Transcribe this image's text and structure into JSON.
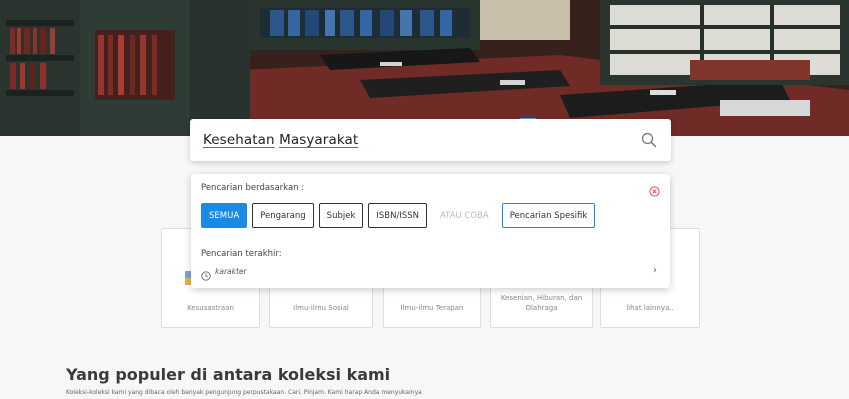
{
  "search": {
    "query_words": [
      "Kesehatan",
      "Masyarakat"
    ]
  },
  "dropdown": {
    "label": "Pencarian berdasarkan :",
    "chips": [
      {
        "label": "SEMUA",
        "state": "active"
      },
      {
        "label": "Pengarang",
        "state": "normal"
      },
      {
        "label": "Subjek",
        "state": "normal"
      },
      {
        "label": "ISBN/ISSN",
        "state": "normal"
      },
      {
        "label": "ATAU COBA",
        "state": "plain"
      },
      {
        "label": "Pencarian Spesifik",
        "state": "outlined"
      }
    ],
    "recent_label": "Pencarian terakhir:",
    "recent_term": "karakter"
  },
  "categories": [
    {
      "label": "Kesusastraan"
    },
    {
      "label": "Ilmu-ilmu Sosial"
    },
    {
      "label": "Ilmu-ilmu Terapan"
    },
    {
      "label": "Kesenian, Hiburan, dan Olahraga"
    },
    {
      "label": "lihat lainnya.."
    }
  ],
  "popular": {
    "title": "Yang populer di antara koleksi kami",
    "subtitle": "Koleksi-koleksi kami yang dibaca oleh banyak pengunjung perpustakaan. Cari, Pinjam. Kami harap Anda menyukainya"
  },
  "colors": {
    "accent": "#1a8ae6",
    "close": "#e05555"
  },
  "icons": {
    "search": "search-icon",
    "close": "close-circle-icon",
    "history": "clock-icon",
    "chevron": "chevron-right-icon"
  }
}
